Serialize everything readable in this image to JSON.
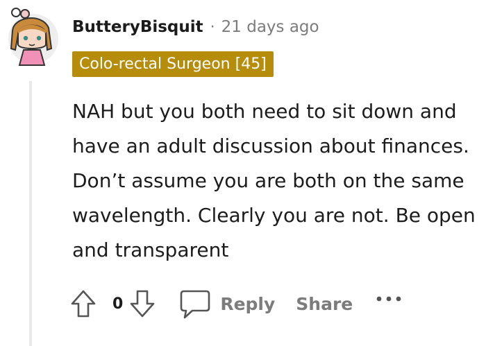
{
  "comment": {
    "username": "ButteryBisquit",
    "separator": "·",
    "age": "21 days ago",
    "flair": "Colo-rectal Surgeon [45]",
    "body": "NAH but you both need to sit down and have an adult discussion about finances. Don’t assume you are both on the same wavelength. Clearly you are not. Be open and transparent",
    "score": "0"
  },
  "actions": {
    "reply_label": "Reply",
    "share_label": "Share"
  },
  "icons": {
    "avatar": "avatar-girl-icon",
    "upvote": "upvote-arrow-icon",
    "downvote": "downvote-arrow-icon",
    "reply": "speech-bubble-icon",
    "more": "more-dots-icon"
  },
  "colors": {
    "flair_background": "#b58d0a",
    "muted_text": "#7c7c7c",
    "text": "#1c1c1c"
  }
}
